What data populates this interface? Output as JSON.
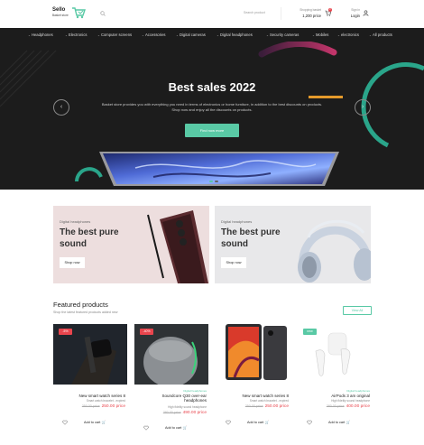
{
  "brand": {
    "name": "Sello",
    "tagline": "Basket store"
  },
  "header": {
    "search_placeholder": "Search product",
    "basket_label": "Shopping basket",
    "basket_total": "1,200 price",
    "basket_count": "2",
    "login_sub": "Sign in",
    "login_label": "Login"
  },
  "nav": {
    "items": [
      "Headphones",
      "Electronics",
      "Computer screens",
      "Accessories",
      "Digital cameras",
      "Digital headphones",
      "Security cameras",
      "Mobiles",
      "electronics",
      "All products"
    ]
  },
  "hero": {
    "title": "Best sales 2022",
    "description": "Basket store provides you with everything you need in terms of electronics or home furniture, in addition to the best discounts on products. Shop now and enjoy all the discounts on products.",
    "button": "Find now more",
    "prev": "‹",
    "next": "›"
  },
  "promos": [
    {
      "category": "Digital headphones",
      "title": "The best pure sound",
      "button": "Shop now"
    },
    {
      "category": "Digital headphones",
      "title": "The best pure sound",
      "button": "Shop now"
    }
  ],
  "featured": {
    "title": "Featured products",
    "subtitle": "Shop the latest featured products added new",
    "view_all": "View All",
    "products": [
      {
        "badge": "-5%",
        "category": "",
        "name": "New smart watch series 8",
        "desc": "Smart watch bracelet - expired",
        "old_price": "350.00 price",
        "new_price": "250.00 price",
        "add": "Add to cart"
      },
      {
        "badge": "-40%",
        "category": "Digital headphones",
        "name": "Soundcore Q30 over-ear headphones",
        "desc": "High fidelity sound headphone",
        "old_price": "380.00 price",
        "new_price": "490.00 price",
        "add": "Add to cart"
      },
      {
        "badge": "",
        "category": "",
        "name": "New smart watch series 8",
        "desc": "Smart watch bracelet - expired",
        "old_price": "350.00 price",
        "new_price": "250.00 price",
        "add": "Add to cart"
      },
      {
        "badge": "new",
        "category": "Digital headphones",
        "name": "AirPods 3 am original",
        "desc": "High fidelity sound headphone",
        "old_price": "380.00 price",
        "new_price": "400.00 price",
        "add": "Add to cart"
      }
    ]
  },
  "colors": {
    "accent": "#59c9a5",
    "sale": "#e8454d",
    "dark": "#1c1c1c"
  }
}
